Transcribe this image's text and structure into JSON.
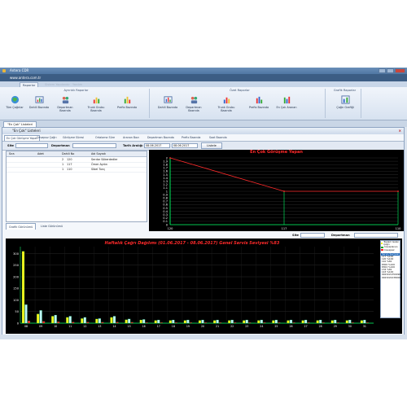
{
  "window": {
    "title": "Antera CDR",
    "address": "www.antera.com.tr"
  },
  "ribbon_tabs": [
    "Raporlar",
    "Sistem Yapılandır",
    "Yardım"
  ],
  "ribbon_groups": [
    {
      "title": "Ayrıntılı Raporlar",
      "buttons": [
        "Tüm Çağrılar",
        "Dahili Bazında",
        "Departman Bazında",
        "Trunk Grubu Bazında",
        "Prefix Bazında"
      ]
    },
    {
      "title": "Özet Raporlar",
      "buttons": [
        "Dahili Bazında",
        "Departman Bazında",
        "Trunk Grubu Bazında",
        "Prefix Bazında",
        "En Çok Aranan"
      ]
    },
    {
      "title": "Grafik Raporlar",
      "buttons": [
        "Çağrı Grafiği"
      ]
    }
  ],
  "document_tab": "\"En Çok\" Listeleri",
  "panel_title": "\"En Çok\" Listeleri",
  "sub_tabs": [
    "En Çok Görüşme Yapan",
    "Cevapsız Çağrı",
    "Görüşme Süresi",
    "Ortalama Süre",
    "Aranan Bazı",
    "Departman Bazında",
    "Prefix Bazında",
    "Saat Bazında"
  ],
  "filter": {
    "site_label": "Site",
    "department_label": "Departman",
    "date_label": "Tarih Aralığı",
    "date_from": "08.06.2017",
    "date_to": "08.06.2017",
    "button": "Listele"
  },
  "grid": {
    "columns": [
      "Sıra",
      "Adet",
      "Dahili No",
      "Adı Soyadı"
    ],
    "rows": [
      {
        "sira": "1",
        "adet": "2",
        "dahili": "120",
        "ad": "Serdar Sökerdedler"
      },
      {
        "sira": "1",
        "adet": "1",
        "dahili": "117",
        "ad": "Ömer Aydın"
      },
      {
        "sira": "1",
        "adet": "1",
        "dahili": "110",
        "ad": "Sibel Tunç"
      }
    ]
  },
  "bottom_tabs": [
    "Grafik Görünümü",
    "Liste Görünümü"
  ],
  "bottom_filter": {
    "site_label": "Site",
    "department_label": "Departman"
  },
  "colors": {
    "chart_bg": "#000000",
    "line": "#ff2a2a",
    "axis": "#00ff66",
    "bar_yellow": "#f5f51a",
    "bar_cyan": "#bff6f6",
    "bar_red": "#ff2222"
  },
  "chart_data": [
    {
      "type": "line",
      "title": "En Çok Görüşme Yapan",
      "x": [
        "120",
        "117",
        "110"
      ],
      "series": [
        {
          "values": [
            2,
            1,
            1
          ]
        }
      ],
      "y_ticks": [
        "0",
        "0.1",
        "0.2",
        "0.3",
        "0.4",
        "0.5",
        "0.6",
        "0.7",
        "0.8",
        "0.9",
        "1",
        "1.1",
        "1.2",
        "1.3",
        "1.4",
        "1.5",
        "1.6",
        "1.7",
        "1.8",
        "1.9",
        "2"
      ],
      "ylim": [
        0,
        2
      ],
      "grid": true
    },
    {
      "type": "bar",
      "title": "Haftalık Çağrı Dağılımı (01.06.2017 - 08.06.2017) Genel Servis Seviyesi %83",
      "y_ticks": [
        "0",
        "50",
        "100",
        "150",
        "200",
        "250",
        "300"
      ],
      "ylim": [
        0,
        330
      ],
      "categories": [
        "08",
        "09",
        "10",
        "11",
        "12",
        "13",
        "14",
        "15",
        "16",
        "17",
        "18",
        "19",
        "20",
        "21",
        "22",
        "23",
        "24",
        "25",
        "26",
        "27",
        "28",
        "29",
        "30",
        "31"
      ],
      "series": [
        {
          "values": [
            310,
            40,
            30,
            25,
            20,
            18,
            25,
            15,
            14,
            12,
            12,
            12,
            12,
            12,
            12,
            12,
            12,
            12,
            12,
            12,
            12,
            12,
            12,
            12
          ]
        },
        {
          "values": [
            80,
            55,
            35,
            30,
            25,
            20,
            30,
            18,
            16,
            14,
            14,
            14,
            14,
            14,
            14,
            14,
            14,
            14,
            14,
            14,
            14,
            14,
            14,
            14
          ]
        },
        {
          "values": [
            10,
            8,
            6,
            5,
            5,
            4,
            5,
            4,
            3,
            3,
            3,
            3,
            3,
            3,
            3,
            3,
            3,
            3,
            3,
            3,
            3,
            3,
            3,
            3
          ]
        }
      ],
      "grid": true,
      "legend": {
        "position": "right",
        "entries": [
          "Toplam Gelen Çağrı",
          "Cevaplanan",
          "Cevapsız"
        ],
        "header": "Servis Seviyesi",
        "rows": [
          "117 %100",
          "120 %100",
          "110 %81",
          "8300 %100",
          "8302 %100",
          "134 %81",
          "143 %100",
          "9023221350090",
          "9023222238000"
        ]
      }
    }
  ]
}
